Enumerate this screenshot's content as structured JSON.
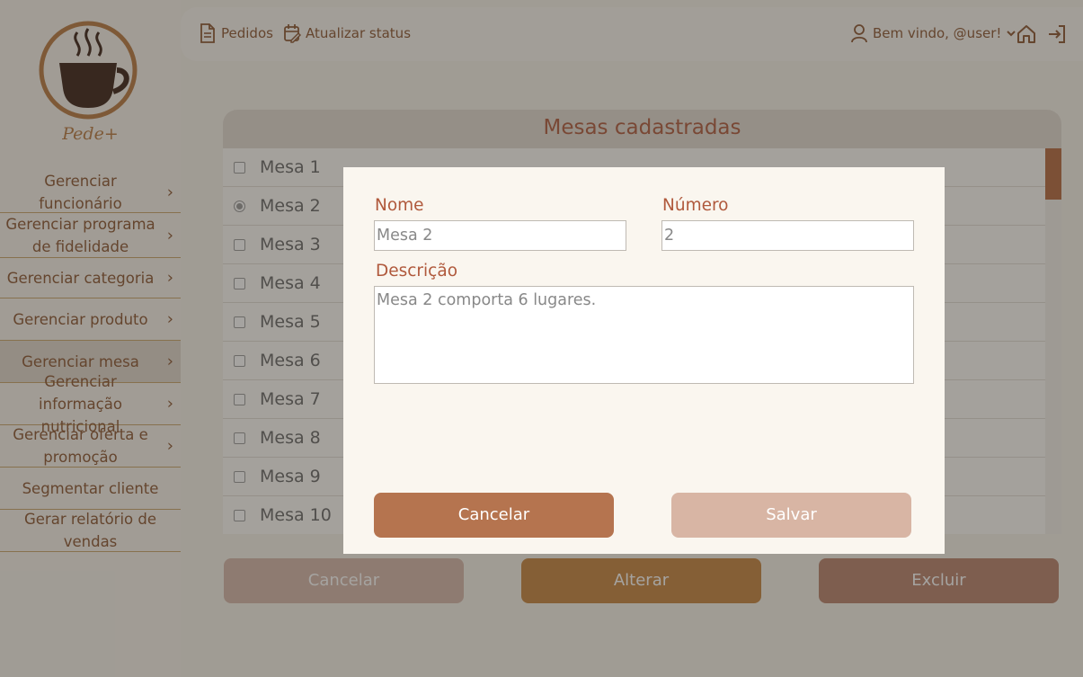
{
  "brand": {
    "logo_text": "Pede+"
  },
  "sidebar": {
    "items": [
      {
        "label": "Gerenciar funcionário",
        "arrow": true
      },
      {
        "label": "Gerenciar programa de fidelidade",
        "arrow": true
      },
      {
        "label": "Gerenciar categoria",
        "arrow": true
      },
      {
        "label": "Gerenciar produto",
        "arrow": true
      },
      {
        "label": "Gerenciar mesa",
        "arrow": true,
        "active": true
      },
      {
        "label": "Gerenciar informação nutricional",
        "arrow": true
      },
      {
        "label": "Gerenciar oferta e promoção",
        "arrow": true
      },
      {
        "label": "Segmentar cliente",
        "arrow": false
      },
      {
        "label": "Gerar relatório de vendas",
        "arrow": false
      }
    ]
  },
  "header": {
    "orders_label": "Pedidos",
    "update_status_label": "Atualizar status",
    "welcome_label": "Bem vindo, @user!"
  },
  "table": {
    "title": "Mesas cadastradas",
    "rows": [
      {
        "label": "Mesa 1",
        "selected": false
      },
      {
        "label": "Mesa 2",
        "selected": true
      },
      {
        "label": "Mesa 3",
        "selected": false
      },
      {
        "label": "Mesa 4",
        "selected": false
      },
      {
        "label": "Mesa 5",
        "selected": false
      },
      {
        "label": "Mesa 6",
        "selected": false
      },
      {
        "label": "Mesa 7",
        "selected": false
      },
      {
        "label": "Mesa 8",
        "selected": false
      },
      {
        "label": "Mesa 9",
        "selected": false
      },
      {
        "label": "Mesa 10",
        "selected": false
      }
    ]
  },
  "actions": {
    "cancel_label": "Cancelar",
    "alter_label": "Alterar",
    "delete_label": "Excluir"
  },
  "modal": {
    "name_label": "Nome",
    "name_value": "Mesa 2",
    "number_label": "Número",
    "number_value": "2",
    "description_label": "Descrição",
    "description_value": "Mesa 2 comporta 6 lugares.",
    "cancel_label": "Cancelar",
    "save_label": "Salvar"
  },
  "colors": {
    "accent": "#b0593c",
    "text_brown": "#8a5531",
    "button_cancel": "#b5744f",
    "button_save": "#d8b5a4",
    "button_alter": "#c5843f",
    "logo_ring": "#b87940",
    "cup": "#3a1f14"
  },
  "icons": {
    "orders": "document-icon",
    "update_status": "calendar-edit-icon",
    "user": "user-icon",
    "dropdown": "chevron-down-icon",
    "home": "home-icon",
    "logout": "logout-icon",
    "menu_arrow": "chevron-right-icon"
  }
}
